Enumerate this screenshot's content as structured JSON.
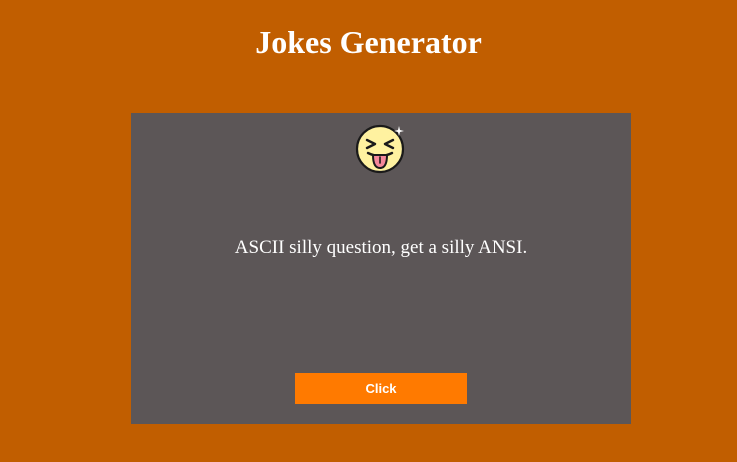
{
  "header": {
    "title": "Jokes Generator"
  },
  "joke_card": {
    "icon": "laughing-tongue-out-emoji-icon",
    "text": "ASCII silly question, get a silly ANSI.",
    "button_label": "Click"
  },
  "colors": {
    "background": "#c15e00",
    "card": "#5c5657",
    "button": "#ff7a00",
    "text": "#ffffff"
  }
}
